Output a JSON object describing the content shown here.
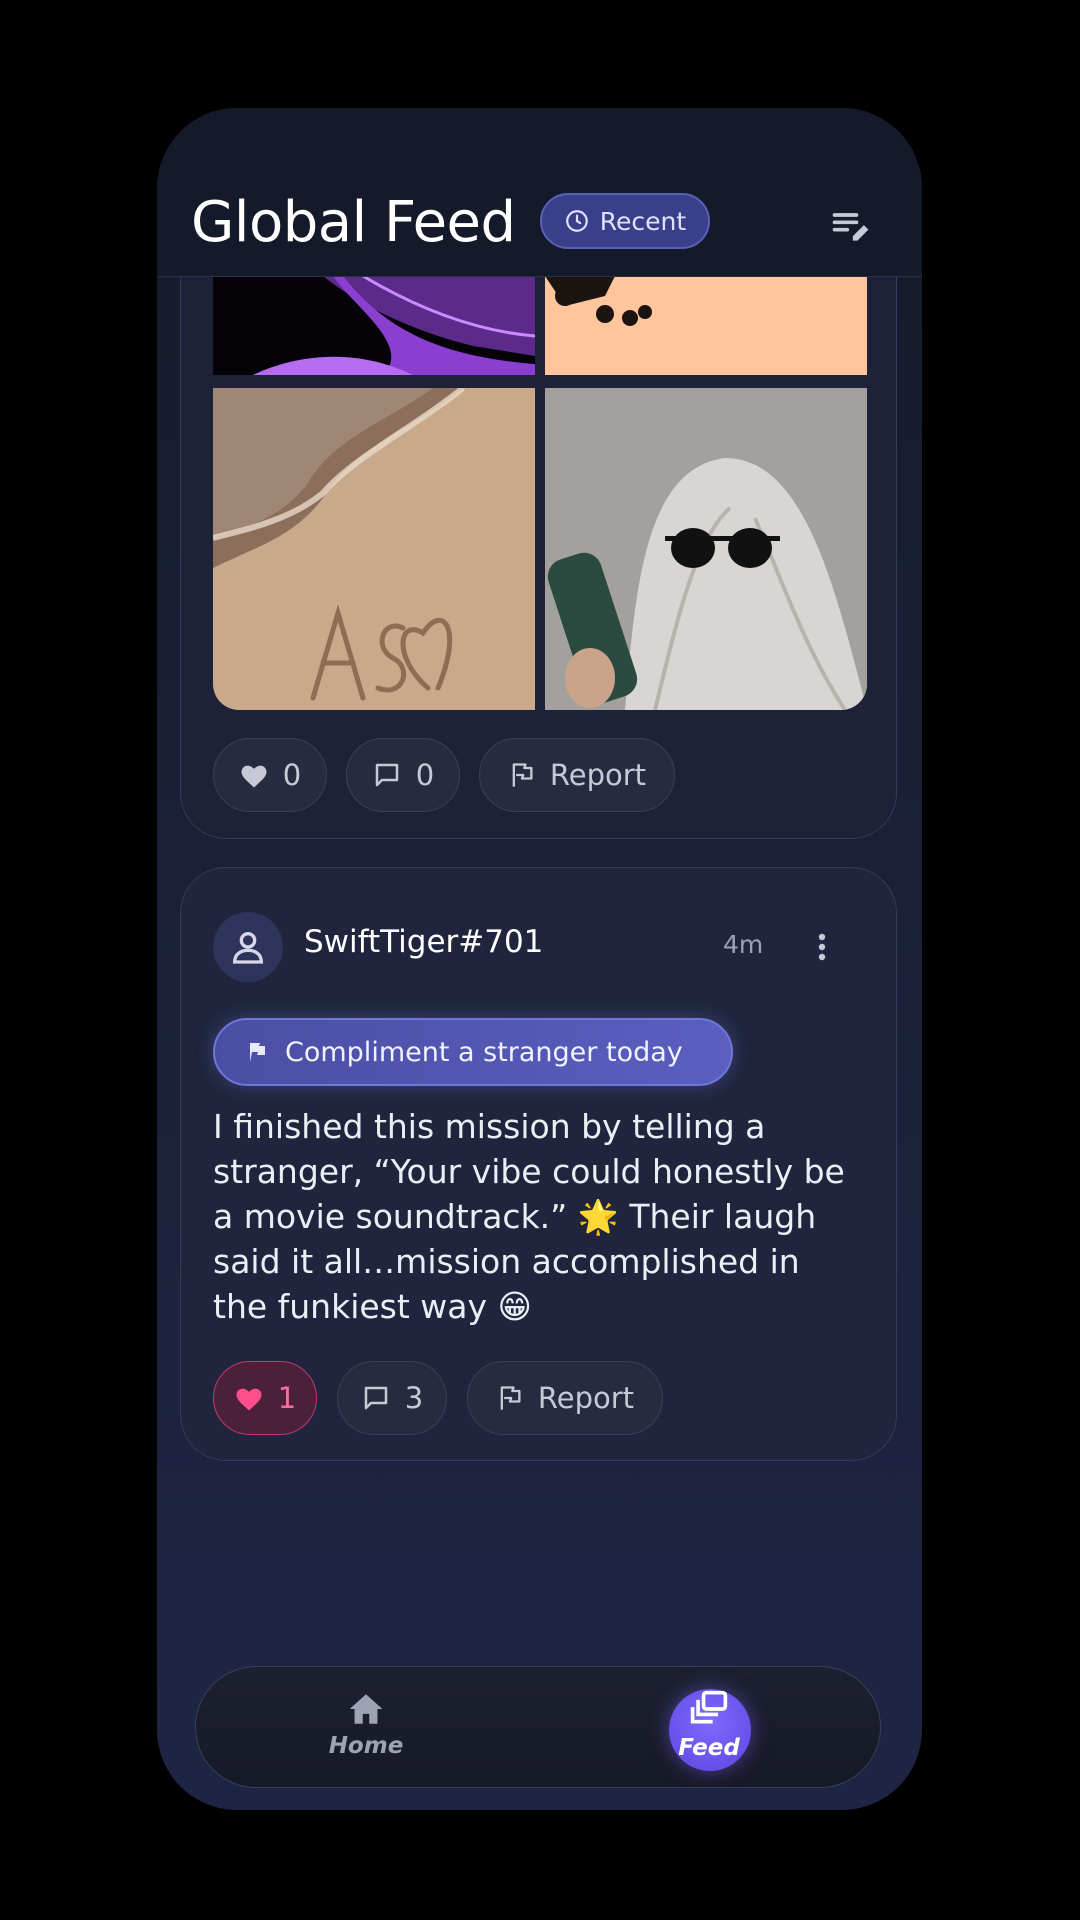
{
  "header": {
    "title": "Global Feed",
    "sort_chip": {
      "label": "Recent",
      "icon": "clock-icon"
    },
    "compose_icon": "compose-icon"
  },
  "post1": {
    "photos": [
      "purple-abstract-image",
      "sunset-tree-image",
      "beach-sand-heart-image",
      "ghost-sunglasses-image"
    ],
    "actions": {
      "like_count": "0",
      "comment_count": "0",
      "report_label": "Report"
    }
  },
  "post2": {
    "username": "SwiftTiger#701",
    "timestamp": "4m",
    "mission": "Compliment a stranger today",
    "text": "I finished this mission by telling a stranger, “Your vibe could honestly be a movie soundtrack.” 🌟 Their laugh said it all…mission accomplished in the funkiest way 😁",
    "actions": {
      "like_count": "1",
      "comment_count": "3",
      "report_label": "Report",
      "liked": true
    }
  },
  "nav": {
    "items": [
      {
        "label": "Home",
        "icon": "home-icon",
        "active": false
      },
      {
        "label": "Feed",
        "icon": "feed-icon",
        "active": true
      }
    ]
  },
  "colors": {
    "accent": "#5a60b8",
    "like_active": "#ff4f8b",
    "background": "#1b2038"
  }
}
